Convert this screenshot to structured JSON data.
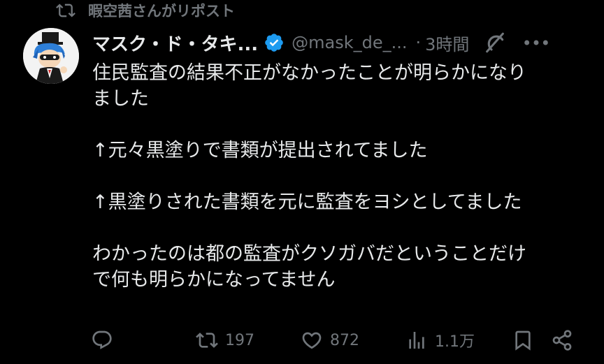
{
  "repost": {
    "label": "暇空茜さんがリポスト",
    "icon": "repost-icon"
  },
  "author": {
    "display_name": "マスク・ド・タキ...",
    "handle": "@mask_de_...",
    "separator": "·",
    "time": "3時間",
    "verified": true,
    "verified_color": "#1d9bf0"
  },
  "tweet": {
    "lines": [
      "住民監査の結果不正がなかったことが明らかになり",
      "ました",
      "",
      "↑元々黒塗りで書類が提出されてました",
      "",
      "↑黒塗りされた書類を元に監査をヨシとしてました",
      "",
      "わかったのは都の監査がクソガバだということだけ",
      "で何も明らかになってません"
    ]
  },
  "actions": {
    "reply": {
      "icon": "reply-icon",
      "count": ""
    },
    "repost": {
      "icon": "repost-icon",
      "count": "197"
    },
    "like": {
      "icon": "heart-icon",
      "count": "872"
    },
    "views": {
      "icon": "views-icon",
      "count": "1.1万"
    },
    "bookmark": {
      "icon": "bookmark-icon"
    },
    "share": {
      "icon": "share-icon"
    }
  },
  "colors": {
    "background": "#000000",
    "text": "#e7e9ea",
    "muted": "#71767b",
    "accent": "#1d9bf0"
  }
}
